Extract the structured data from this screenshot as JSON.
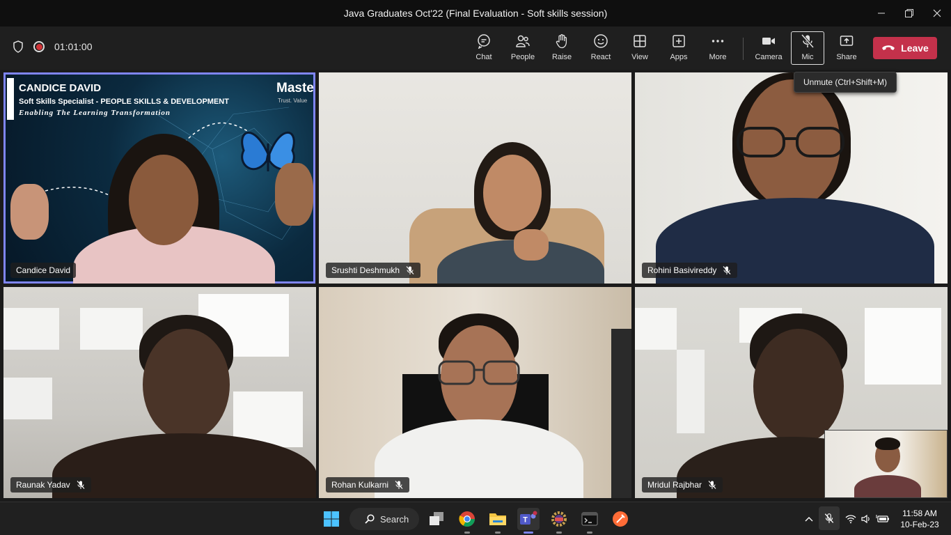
{
  "window": {
    "title": "Java Graduates Oct'22 (Final Evaluation - Soft skills session)"
  },
  "meeting": {
    "timer": "01:01:00"
  },
  "toolbar": {
    "chat": "Chat",
    "people": "People",
    "raise": "Raise",
    "react": "React",
    "view": "View",
    "apps": "Apps",
    "more": "More",
    "camera": "Camera",
    "mic": "Mic",
    "share": "Share",
    "leave": "Leave"
  },
  "tooltip": "Unmute (Ctrl+Shift+M)",
  "slide": {
    "name": "CANDICE DAVID",
    "role": "Soft Skills Specialist - PEOPLE SKILLS & DEVELOPMENT",
    "tagline": "Enabling The Learning Transformation",
    "logo": "Maste",
    "logo_tag": "Trust. Value"
  },
  "participants": [
    {
      "name": "Candice David",
      "muted": false,
      "speaking": true
    },
    {
      "name": "Srushti Deshmukh",
      "muted": true
    },
    {
      "name": "Rohini Basivireddy",
      "muted": true
    },
    {
      "name": "Raunak Yadav",
      "muted": true
    },
    {
      "name": "Rohan Kulkarni",
      "muted": true
    },
    {
      "name": "Mridul Rajbhar",
      "muted": true
    }
  ],
  "taskbar": {
    "search": "Search",
    "time": "11:58 AM",
    "date": "10-Feb-23"
  },
  "colors": {
    "leave": "#c4314b",
    "speaker_outline": "#7f85f5",
    "recording": "#d13438"
  }
}
